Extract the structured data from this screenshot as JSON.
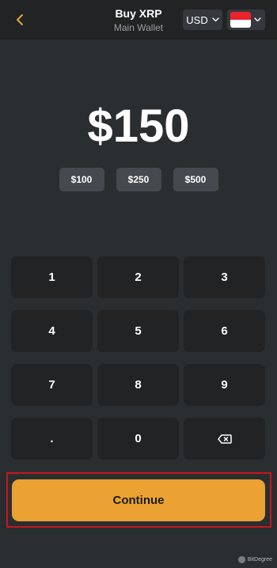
{
  "header": {
    "title": "Buy XRP",
    "subtitle": "Main Wallet",
    "currency": "USD",
    "flag_icon": "indonesia-flag-icon"
  },
  "amount": {
    "display": "$150"
  },
  "presets": [
    "$100",
    "$250",
    "$500"
  ],
  "keypad": {
    "keys": [
      "1",
      "2",
      "3",
      "4",
      "5",
      "6",
      "7",
      "8",
      "9",
      ".",
      "0"
    ],
    "backspace_icon": "backspace-icon"
  },
  "actions": {
    "continue_label": "Continue"
  },
  "watermark": {
    "text": "BitDegree"
  },
  "colors": {
    "accent": "#eba232",
    "back_icon": "#eba232",
    "highlight_border": "#c8161f",
    "flag_red": "#e8242c",
    "flag_white": "#ffffff"
  }
}
